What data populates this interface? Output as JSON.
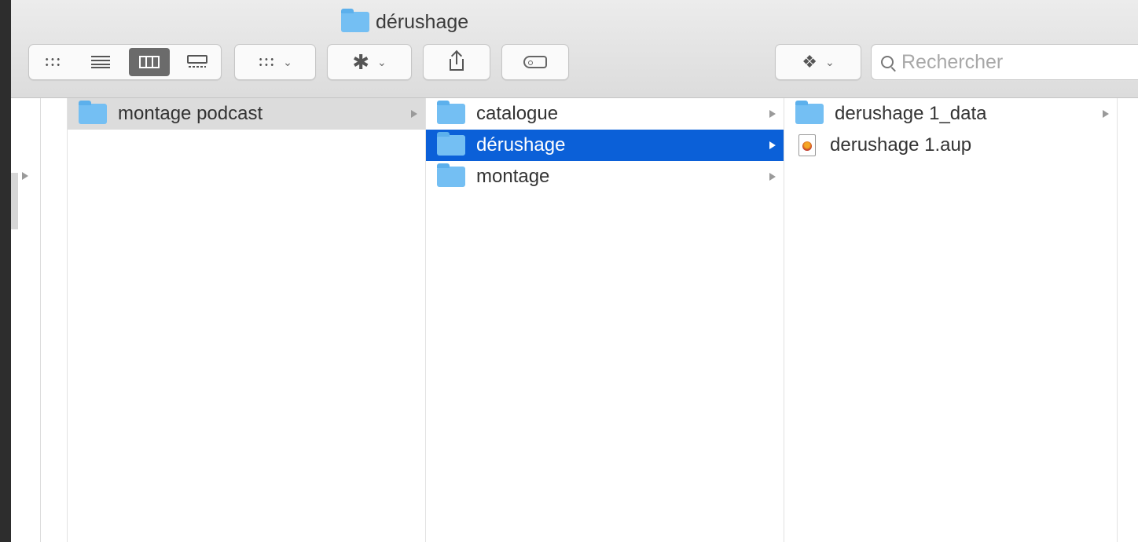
{
  "window": {
    "title": "dérushage"
  },
  "toolbar": {
    "search": {
      "placeholder": "Rechercher",
      "value": ""
    },
    "view_modes": [
      "icon",
      "list",
      "column",
      "gallery"
    ],
    "active_view": "column"
  },
  "columns": {
    "col1": {
      "items": [
        {
          "label": "montage podcast",
          "type": "folder",
          "state": "selected-inactive"
        }
      ]
    },
    "col2": {
      "items": [
        {
          "label": "catalogue",
          "type": "folder"
        },
        {
          "label": "dérushage",
          "type": "folder",
          "state": "selected"
        },
        {
          "label": "montage",
          "type": "folder"
        }
      ]
    },
    "col3": {
      "items": [
        {
          "label": "derushage 1_data",
          "type": "folder"
        },
        {
          "label": "derushage 1.aup",
          "type": "audacity-file"
        }
      ]
    }
  },
  "colors": {
    "selection": "#0b60d8",
    "folder": "#74bff3",
    "inactive_selection": "#dcdcdc"
  }
}
